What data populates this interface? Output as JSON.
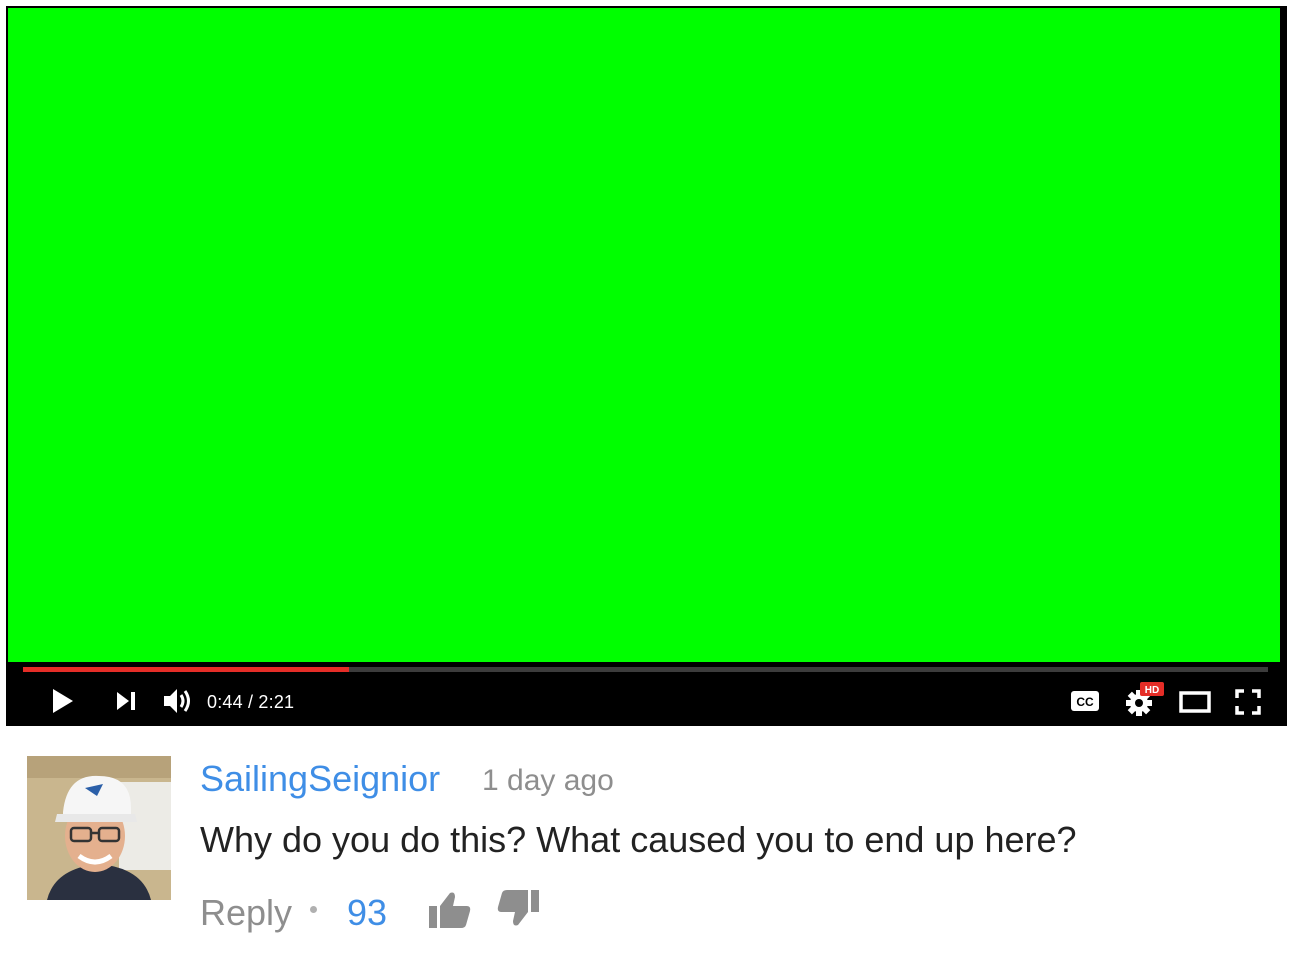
{
  "colors": {
    "video_background": "#00ff00",
    "progress_played": "#e52d27",
    "link_blue": "#3f8ee6",
    "muted_gray": "#8e8e8e"
  },
  "player": {
    "progress": 0.262,
    "time_display": "0:44 / 2:21",
    "controls": {
      "play_icon": "play-icon",
      "next_icon": "next-icon",
      "volume_icon": "volume-icon",
      "captions_label": "CC",
      "captions_icon": "captions-icon",
      "settings_icon": "settings-gear-icon",
      "hd_badge": "HD",
      "theater_icon": "theater-mode-icon",
      "fullscreen_icon": "fullscreen-icon"
    }
  },
  "comment": {
    "author": "SailingSeignior",
    "timestamp": "1 day ago",
    "text": "Why do you do this? What caused you to end up here?",
    "reply_label": "Reply",
    "like_count": "93",
    "like_icon": "thumbs-up-icon",
    "dislike_icon": "thumbs-down-icon",
    "avatar_icon": "user-avatar"
  }
}
